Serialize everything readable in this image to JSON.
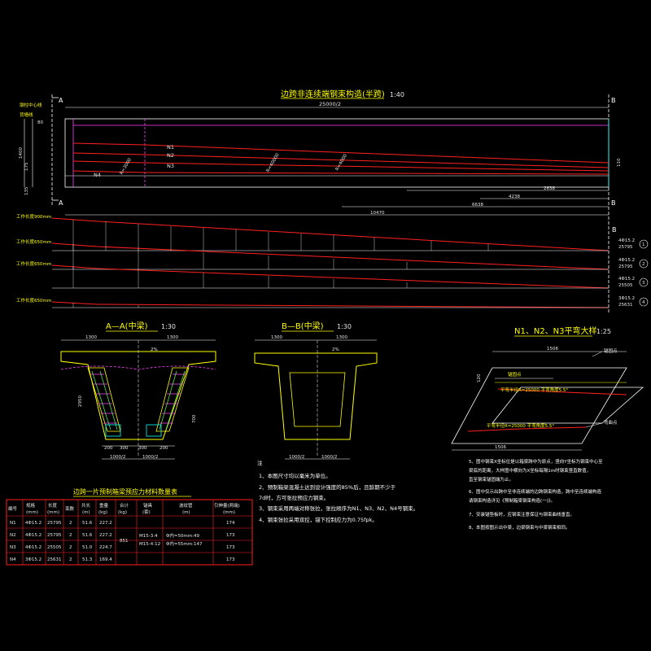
{
  "main_title": "边跨非连续端钢束构造(半跨)",
  "main_scale": "1:40",
  "markers": {
    "A": "A",
    "B": "B"
  },
  "left_label_top": "墩柱中心线",
  "left_label_bottom": "背墙线",
  "elev_dims": {
    "half_len": "25000/2",
    "total_h": "1400",
    "d80": "80",
    "d175": "175",
    "d135": "135",
    "d4238": "4238",
    "d2638": "2638",
    "d6638": "6638",
    "d10470": "10470",
    "d110": "110"
  },
  "tendon_labels": [
    "N1",
    "N2",
    "N3",
    "N4"
  ],
  "radius_labels": [
    "R=3000",
    "R=40000",
    "R=4000"
  ],
  "profile_row_labels": [
    "工作长度900mm",
    "工作长度650mm",
    "工作长度650mm",
    "工作长度650mm"
  ],
  "profile_steel": [
    {
      "spec": "4Φ15.2",
      "len": "25795",
      "num": "1"
    },
    {
      "spec": "4Φ15.2",
      "len": "25795",
      "num": "2"
    },
    {
      "spec": "4Φ15.2",
      "len": "25505",
      "num": "3"
    },
    {
      "spec": "3Φ15.2",
      "len": "25631",
      "num": "4"
    }
  ],
  "section_aa": {
    "title": "A—A(中梁)",
    "scale": "1:30",
    "w1": "1300",
    "w2": "1300",
    "slope": "2%",
    "h1": "2950",
    "h2": "700",
    "bot_dims": [
      "200",
      "300",
      "300",
      "200"
    ],
    "bot_half": [
      "1000/2",
      "1000/2"
    ]
  },
  "section_bb": {
    "title": "B—B(中梁)",
    "scale": "1:30",
    "w1": "1300",
    "w2": "1300",
    "slope": "2%",
    "bot_half": [
      "1000/2",
      "1000/2"
    ]
  },
  "detail_n": {
    "title": "N1、N2、N3平弯大样",
    "scale": "1:25",
    "dim_top": "1506",
    "dim_bot": "1506",
    "dim_left": "120",
    "anchor": "锚固点",
    "arc_label": "平弯半径R=25000  平弯角度5.5°",
    "bend_label": "弯曲点",
    "pt1": "锚固点",
    "pt2": "弯曲点"
  },
  "table": {
    "title": "边跨一片预制箱梁预应力材料数量表",
    "headers": [
      "编号",
      "规格",
      "长度",
      "束数",
      "共长",
      "重量",
      "合计",
      "锚具",
      "波纹管",
      "引伸量(两端)"
    ],
    "units": [
      "",
      "(mm)",
      "(mm)",
      "",
      "(m)",
      "(kg)",
      "(kg)",
      "(套)",
      "(m)",
      "(mm)"
    ],
    "rows": [
      [
        "N1",
        "4Φ15.2",
        "25795",
        "2",
        "51.6",
        "227.2",
        "174"
      ],
      [
        "N2",
        "4Φ15.2",
        "25795",
        "2",
        "51.6",
        "227.2",
        "173"
      ],
      [
        "N3",
        "4Φ15.2",
        "25505",
        "2",
        "51.0",
        "224.7",
        "173"
      ],
      [
        "N4",
        "3Φ15.2",
        "25631",
        "2",
        "51.3",
        "169.4",
        "173"
      ]
    ],
    "total": "851",
    "anchors": [
      "M15-3:4",
      "M15-4:12"
    ],
    "ducts": [
      "Φ内=50mm:49",
      "Φ内=55mm:147"
    ]
  },
  "notes_title": "注",
  "notes_left": [
    "1、本图尺寸均以毫米为单位。",
    "2、预制箱梁混凝土达到设计强度的85%后，且龄期不少于",
    "   7d时，方可张拉预应力钢束。",
    "3、钢束采用两端对称张拉，张拉顺序为N1、N3、N2、N4号钢束。",
    "4、钢束张拉采用双控，锚下控制应力为0.75fpk。"
  ],
  "notes_right": [
    "5、图中钢束X坐标位是以箱梁跨中为原点，竖向Y坐标为钢束中心至",
    "   梁底的距离，大样图中横向为X坐标每隔1m时钢束竖直数值，",
    "   直至钢束锚固端为止。",
    "6、图中仅示出跨中至非连续端的边跨钢束构造，跨中至连续端构造",
    "   请钢束构造详见《预制箱梁钢束构造(一)》。",
    "7、安装锚垫板时，应钢束注意保证与钢束曲线垂直。",
    "8、本图按图示出中梁，边梁钢束与中梁钢束相同。"
  ],
  "colors": {
    "red": "#ff2020",
    "yellow": "#ffff00",
    "magenta": "#ff40ff",
    "cyan": "#00ffff",
    "white": "#ffffff",
    "green": "#40ff40"
  }
}
